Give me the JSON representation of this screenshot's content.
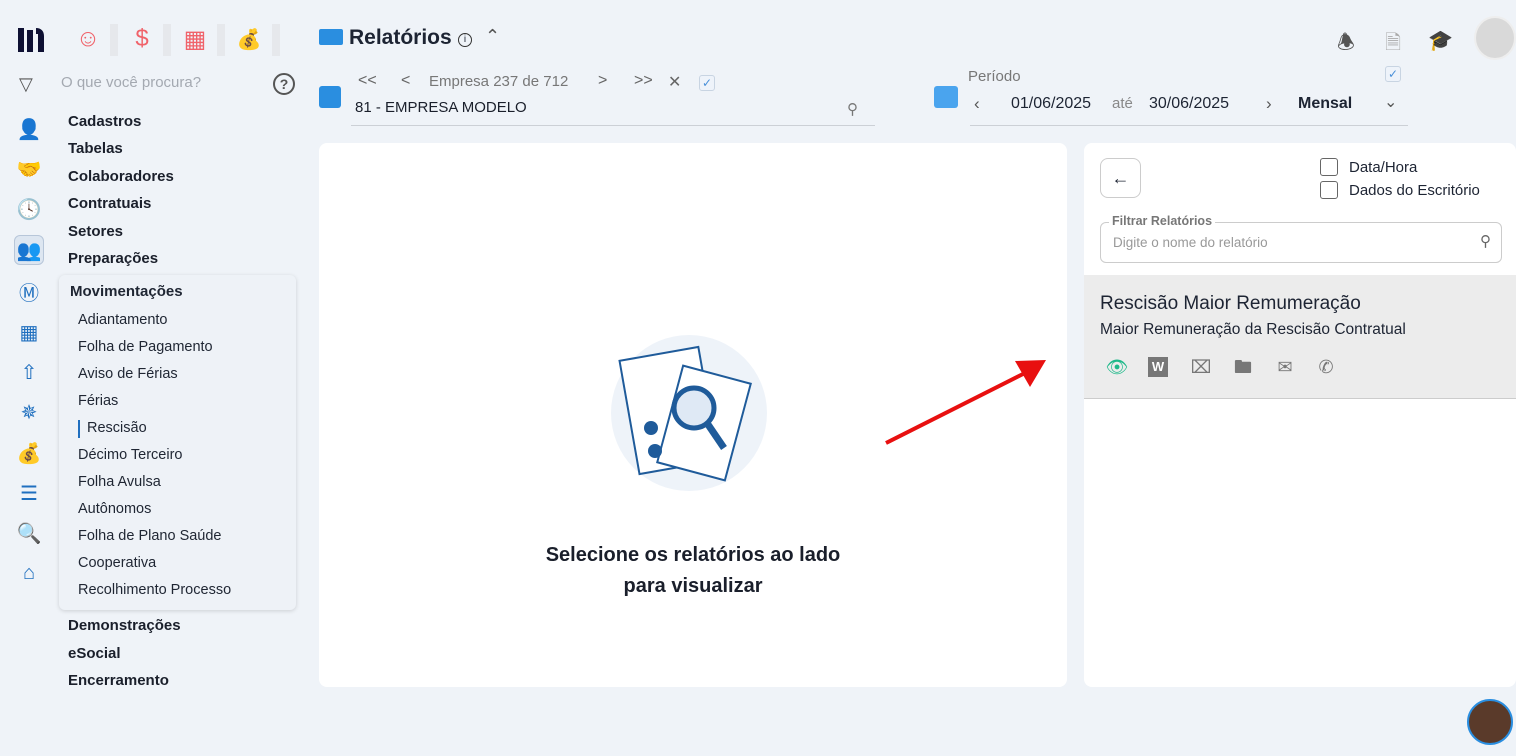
{
  "app": {
    "search_placeholder": "O que você procura?",
    "help": "?"
  },
  "header": {
    "title": "Relatórios",
    "info": "i"
  },
  "company": {
    "first": "<<",
    "prev": "<",
    "label": "Empresa",
    "current": "237",
    "of": "de",
    "total": "712",
    "next": ">",
    "last": ">>",
    "clear": "✕",
    "selected": "81 - EMPRESA MODELO"
  },
  "period": {
    "label": "Período",
    "start": "01/06/2025",
    "until": "até",
    "end": "30/06/2025",
    "mode": "Mensal"
  },
  "menu": {
    "top": [
      "Cadastros",
      "Tabelas",
      "Colaboradores",
      "Contratuais",
      "Setores",
      "Preparações"
    ],
    "open": "Movimentações",
    "sub": [
      "Adiantamento",
      "Folha de Pagamento",
      "Aviso de Férias",
      "Férias",
      "Rescisão",
      "Décimo Terceiro",
      "Folha Avulsa",
      "Autônomos",
      "Folha de Plano Saúde",
      "Cooperativa",
      "Recolhimento Processo"
    ],
    "bottom": [
      "Demonstrações",
      "eSocial",
      "Encerramento"
    ]
  },
  "empty": {
    "line1": "Selecione os relatórios ao lado",
    "line2": "para visualizar"
  },
  "right": {
    "opt1": "Data/Hora",
    "opt2": "Dados do Escritório",
    "filter_label": "Filtrar Relatórios",
    "filter_placeholder": "Digite o nome do relatório",
    "report": {
      "title": "Rescisão Maior Remumeração",
      "subtitle": "Maior Remuneração da Rescisão Contratual"
    }
  },
  "colors": {
    "accent": "#1f6fbf",
    "red": "#f0626a",
    "green": "#1fb98a"
  }
}
